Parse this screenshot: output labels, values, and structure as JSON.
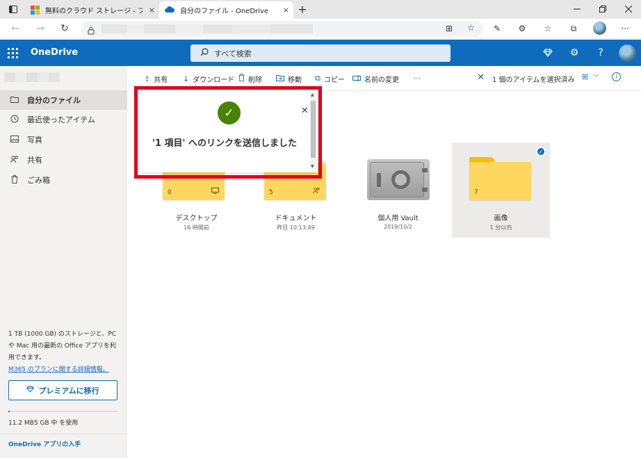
{
  "browser": {
    "tabs": [
      {
        "title": "無料のクラウド ストレージ - ファイル共",
        "active": false
      },
      {
        "title": "自分のファイル - OneDrive",
        "active": true
      }
    ],
    "new_tab": "+",
    "tab_close": "×",
    "more": "···"
  },
  "app": {
    "brand": "OneDrive",
    "search_placeholder": "すべて検索",
    "help": "?"
  },
  "nav": {
    "items": [
      {
        "label": "自分のファイル",
        "icon": "folder-icon",
        "active": true
      },
      {
        "label": "最近使ったアイテム",
        "icon": "clock-icon",
        "active": false
      },
      {
        "label": "写真",
        "icon": "image-icon",
        "active": false
      },
      {
        "label": "共有",
        "icon": "people-icon",
        "active": false
      },
      {
        "label": "ごみ箱",
        "icon": "trash-icon",
        "active": false
      }
    ],
    "storage_info": "1 TB (1000 GB) のストレージと、PC や Mac 用の最新の Office アプリを利用できます。",
    "plan_link": "M365 のプランに関する詳細情報。",
    "premium_button": "プレミアムに移行",
    "usage_text": "11.2 MB5 GB 中 を使用",
    "usage_fraction": 0.002,
    "get_apps": "OneDrive アプリの入手"
  },
  "commands": {
    "share": "共有",
    "download": "ダウンロード",
    "delete": "削除",
    "move": "移動",
    "copy": "コピー",
    "rename": "名前の変更",
    "more": "···",
    "selection": "1 個のアイテムを選択済み"
  },
  "toast": {
    "message": "'1 項目' へのリンクを送信しました"
  },
  "items": [
    {
      "name": "デスクトップ",
      "date": "16 時間前",
      "count": "0"
    },
    {
      "name": "ドキュメント",
      "date": "昨日 10:13:49",
      "count": "5"
    },
    {
      "name": "個人用 Vault",
      "date": "2019/10/2"
    },
    {
      "name": "画像",
      "date": "1 分以内",
      "count": "7"
    }
  ],
  "colors": {
    "brand_blue": "#0f6cbd",
    "folder_yellow": "#ffd75e",
    "success_green": "#498205",
    "highlight_red": "#e1001d"
  }
}
